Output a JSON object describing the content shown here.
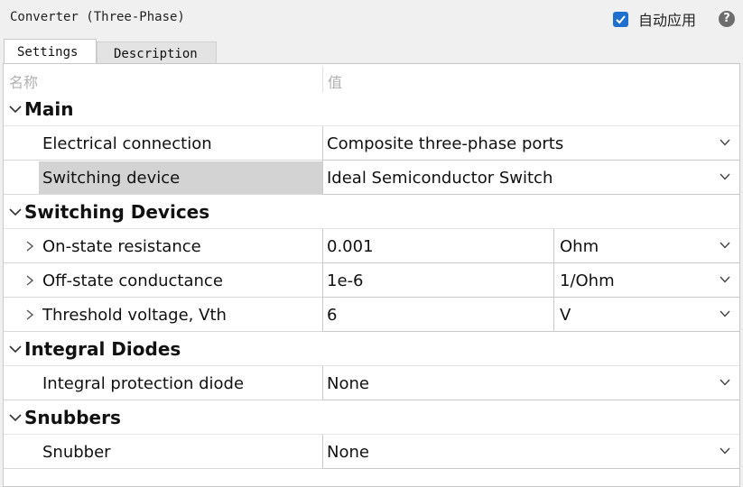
{
  "window": {
    "title": "Converter (Three-Phase)",
    "auto_apply_label": "自动应用",
    "auto_apply_checked": true,
    "help_glyph": "?"
  },
  "tabs": [
    {
      "label": "Settings",
      "active": true
    },
    {
      "label": "Description",
      "active": false
    }
  ],
  "table": {
    "header": {
      "name": "名称",
      "value": "值"
    },
    "sections": [
      {
        "title": "Main"
      },
      {
        "title": "Switching Devices"
      },
      {
        "title": "Integral Diodes"
      },
      {
        "title": "Snubbers"
      }
    ],
    "rows": {
      "electrical_connection": {
        "name": "Electrical connection",
        "value": "Composite three-phase ports"
      },
      "switching_device": {
        "name": "Switching device",
        "value": "Ideal Semiconductor Switch"
      },
      "on_state_resistance": {
        "name": "On-state resistance",
        "value": "0.001",
        "unit": "Ohm"
      },
      "off_state_conductance": {
        "name": "Off-state conductance",
        "value": "1e-6",
        "unit": "1/Ohm"
      },
      "threshold_voltage": {
        "name": "Threshold voltage, Vth",
        "value": "6",
        "unit": "V"
      },
      "integral_protection_diode": {
        "name": "Integral protection diode",
        "value": "None"
      },
      "snubber": {
        "name": "Snubber",
        "value": "None"
      }
    }
  },
  "colors": {
    "accent": "#1f6fce",
    "selected_row": "#d3d3d3"
  },
  "icons": {
    "checkbox": "checkmark-icon",
    "help": "help-icon",
    "section": "chevron-down-icon",
    "expand": "chevron-right-icon",
    "dropdown": "chevron-down-icon"
  }
}
